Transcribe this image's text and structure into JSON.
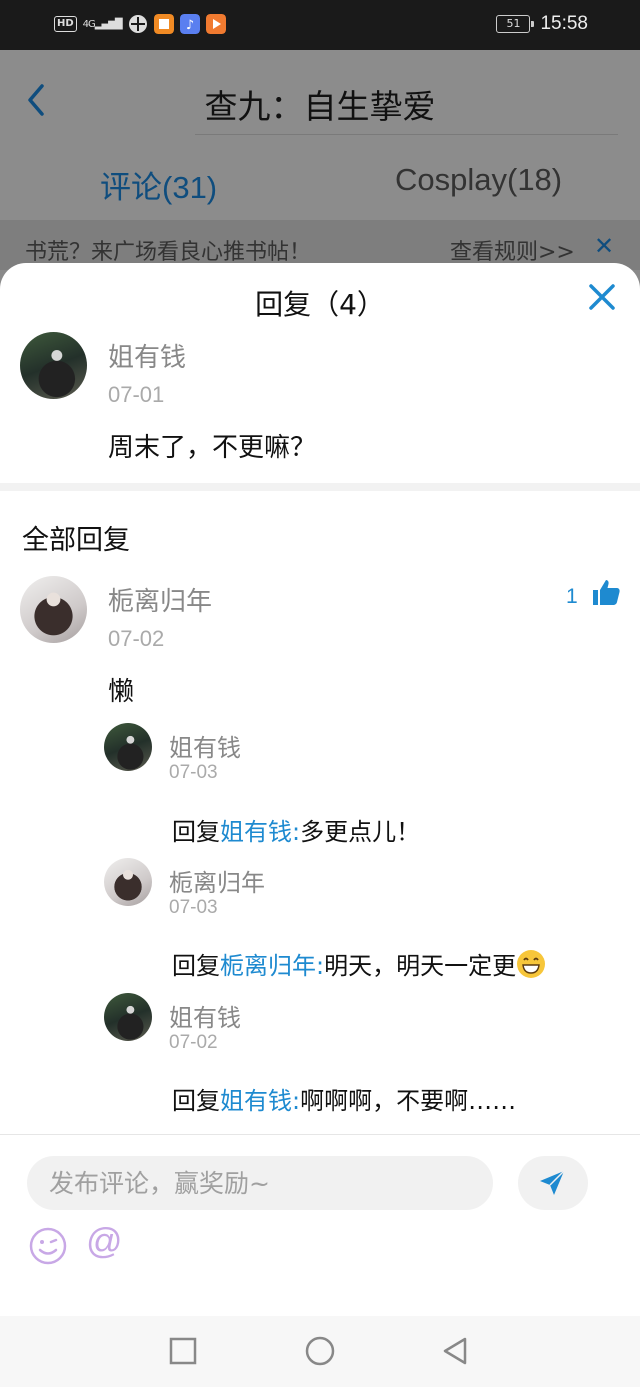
{
  "status_bar": {
    "network": "HD",
    "signal": "4G",
    "battery": "51",
    "time": "15:58"
  },
  "header": {
    "title": "查九：自生挚爱",
    "tabs": [
      {
        "label": "评论(31)",
        "active": true
      },
      {
        "label": "Cosplay(18)",
        "active": false
      }
    ]
  },
  "notice": {
    "text": "书荒？来广场看良心推书帖！",
    "rules_link": "查看规则>>",
    "close": "✕"
  },
  "sheet": {
    "title": "回复（4）",
    "original": {
      "user": "姐有钱",
      "date": "07-01",
      "text": "周末了，不更嘛？"
    },
    "section_title": "全部回复",
    "comment": {
      "user": "栀离归年",
      "date": "07-02",
      "text": "懒",
      "likes": "1"
    },
    "replies": [
      {
        "user": "姐有钱",
        "date": "07-03",
        "prefix": "回复",
        "mention": "姐有钱:",
        "text": "多更点儿！"
      },
      {
        "user": "栀离归年",
        "date": "07-03",
        "prefix": "回复",
        "mention": "栀离归年:",
        "text": "明天，明天一定更"
      },
      {
        "user": "姐有钱",
        "date": "07-02",
        "prefix": "回复",
        "mention": "姐有钱:",
        "text": "啊啊啊，不要啊……"
      }
    ]
  },
  "input": {
    "placeholder": "发布评论，赢奖励~",
    "at": "@"
  },
  "colors": {
    "accent": "#1e8ad0",
    "dim_overlay": "#8a8a8a",
    "emoji_tint": "#c8a8e6"
  }
}
